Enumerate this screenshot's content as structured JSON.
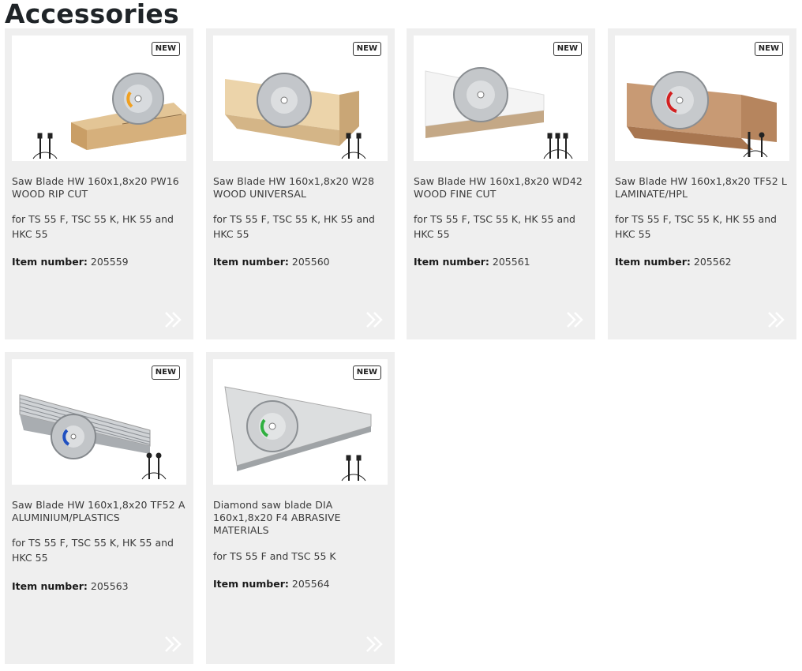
{
  "page": {
    "title": "Accessories"
  },
  "products": [
    {
      "badge": "NEW",
      "title": "Saw Blade HW 160x1,8x20 PW16 WOOD RIP CUT",
      "compat": "for TS 55 F, TSC 55 K, HK 55 and HKC 55",
      "item_label": "Item number:",
      "item_number": "205559",
      "image": "wood-rip-cut-blade"
    },
    {
      "badge": "NEW",
      "title": "Saw Blade HW 160x1,8x20 W28 WOOD UNIVERSAL",
      "compat": "for TS 55 F, TSC 55 K, HK 55 and HKC 55",
      "item_label": "Item number:",
      "item_number": "205560",
      "image": "wood-universal-blade"
    },
    {
      "badge": "NEW",
      "title": "Saw Blade HW 160x1,8x20 WD42 WOOD FINE CUT",
      "compat": "for TS 55 F, TSC 55 K, HK 55 and HKC 55",
      "item_label": "Item number:",
      "item_number": "205561",
      "image": "wood-fine-cut-blade"
    },
    {
      "badge": "NEW",
      "title": "Saw Blade HW 160x1,8x20 TF52 L LAMINATE/HPL",
      "compat": "for TS 55 F, TSC 55 K, HK 55 and HKC 55",
      "item_label": "Item number:",
      "item_number": "205562",
      "image": "laminate-blade"
    },
    {
      "badge": "NEW",
      "title": "Saw Blade HW 160x1,8x20 TF52 A ALUMINIUM/PLASTICS",
      "compat": "for TS 55 F, TSC 55 K, HK 55 and HKC 55",
      "item_label": "Item number:",
      "item_number": "205563",
      "image": "aluminium-blade"
    },
    {
      "badge": "NEW",
      "title": "Diamond saw blade DIA 160x1,8x20 F4 ABRASIVE MATERIALS",
      "compat": "for TS 55 F and TSC 55 K",
      "item_label": "Item number:",
      "item_number": "205564",
      "image": "diamond-blade"
    }
  ],
  "colors": {
    "card_bg": "#efefef",
    "wood": "#d9b98a",
    "laminate": "#c99a72",
    "aluminium": "#b8bcc0",
    "hub_orange": "#f0a020",
    "hub_red": "#d32020",
    "hub_blue": "#2050c0",
    "hub_green": "#30b040"
  }
}
